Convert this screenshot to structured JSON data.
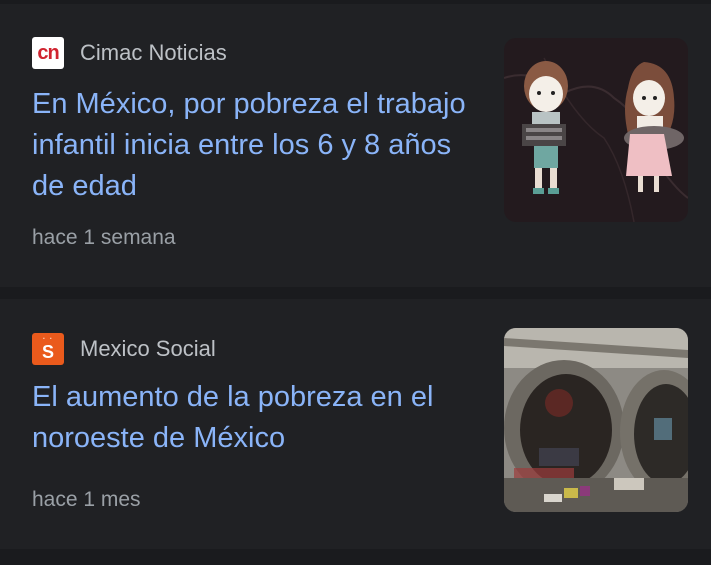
{
  "articles": [
    {
      "source": "Cimac Noticias",
      "favicon_text": "cn",
      "favicon_icon": "cimac-noticias-logo-icon",
      "headline": "En México, por pobreza el trabajo infantil inicia entre los 6 y 8 años de edad",
      "time": "hace 1 semana",
      "thumbnail": "illustration of two children working"
    },
    {
      "source": "Mexico Social",
      "favicon_text": "S",
      "favicon_icon": "mexico-social-logo-icon",
      "headline": "El aumento de la pobreza en el noroeste de México",
      "time": "hace 1 mes",
      "thumbnail": "photo of people living in concrete pipes"
    }
  ],
  "colors": {
    "background": "#1a1b1e",
    "card": "#202124",
    "headline": "#8ab4f8",
    "source": "#bdc1c6",
    "time": "#9aa0a6",
    "cn_red": "#d0232f",
    "ms_orange": "#ea5a1c"
  }
}
